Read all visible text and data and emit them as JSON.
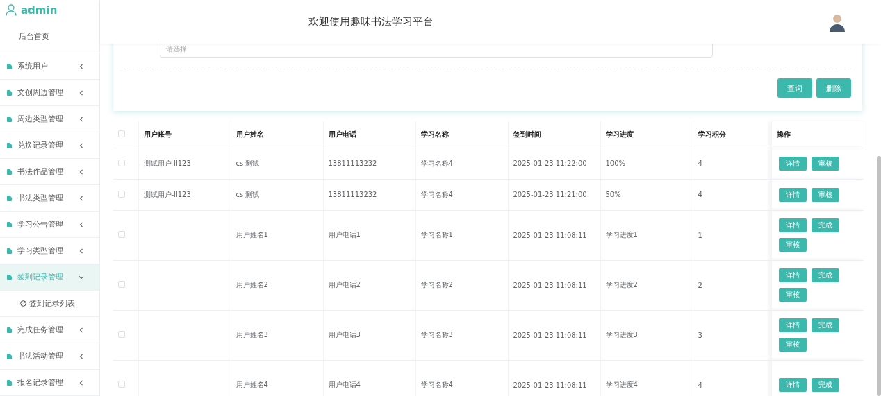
{
  "sidebar": {
    "user": "admin",
    "items": [
      {
        "label": "后台首页",
        "kind": "home",
        "selected": false
      },
      {
        "label": "系统用户",
        "kind": "menu",
        "selected": false,
        "expanded": false
      },
      {
        "label": "文创周边管理",
        "kind": "menu",
        "selected": false,
        "expanded": false
      },
      {
        "label": "周边类型管理",
        "kind": "menu",
        "selected": false,
        "expanded": false
      },
      {
        "label": "兑换记录管理",
        "kind": "menu",
        "selected": false,
        "expanded": false
      },
      {
        "label": "书法作品管理",
        "kind": "menu",
        "selected": false,
        "expanded": false
      },
      {
        "label": "书法类型管理",
        "kind": "menu",
        "selected": false,
        "expanded": false
      },
      {
        "label": "学习公告管理",
        "kind": "menu",
        "selected": false,
        "expanded": false
      },
      {
        "label": "学习类型管理",
        "kind": "menu",
        "selected": false,
        "expanded": false
      },
      {
        "label": "签到记录管理",
        "kind": "menu",
        "selected": true,
        "expanded": true,
        "children": [
          {
            "label": "签到记录列表"
          }
        ]
      },
      {
        "label": "完成任务管理",
        "kind": "menu",
        "selected": false,
        "expanded": false
      },
      {
        "label": "书法活动管理",
        "kind": "menu",
        "selected": false,
        "expanded": false
      },
      {
        "label": "报名记录管理",
        "kind": "menu",
        "selected": false,
        "expanded": false
      }
    ]
  },
  "header": {
    "title": "欢迎使用趣味书法学习平台"
  },
  "search": {
    "placeholder": "请选择",
    "buttons": [
      "查询",
      "删除"
    ]
  },
  "table": {
    "all_selected": false,
    "columns": [
      "用户账号",
      "用户姓名",
      "用户电话",
      "学习名称",
      "签到时间",
      "学习进度",
      "学习积分",
      "操作"
    ],
    "rows": [
      {
        "selected": false,
        "cells": [
          "测试用户-ll123",
          "cs 测试",
          "13811113232",
          "学习名称4",
          "2025-01-23 11:22:00",
          "100%",
          "4"
        ],
        "actions": [
          "详情",
          "审核"
        ]
      },
      {
        "selected": false,
        "cells": [
          "测试用户-ll123",
          "cs 测试",
          "13811113232",
          "学习名称4",
          "2025-01-23 11:21:00",
          "50%",
          "4"
        ],
        "actions": [
          "详情",
          "审核"
        ]
      },
      {
        "selected": false,
        "cells": [
          "",
          "用户姓名1",
          "用户电话1",
          "学习名称1",
          "2025-01-23 11:08:11",
          "学习进度1",
          "1"
        ],
        "actions": [
          "详情",
          "完成",
          "审核"
        ]
      },
      {
        "selected": false,
        "cells": [
          "",
          "用户姓名2",
          "用户电话2",
          "学习名称2",
          "2025-01-23 11:08:11",
          "学习进度2",
          "2"
        ],
        "actions": [
          "详情",
          "完成",
          "审核"
        ]
      },
      {
        "selected": false,
        "cells": [
          "",
          "用户姓名3",
          "用户电话3",
          "学习名称3",
          "2025-01-23 11:08:11",
          "学习进度3",
          "3"
        ],
        "actions": [
          "详情",
          "完成",
          "审核"
        ]
      },
      {
        "selected": false,
        "cells": [
          "",
          "用户姓名4",
          "用户电话4",
          "学习名称4",
          "2025-01-23 11:08:11",
          "学习进度4",
          "4"
        ],
        "actions": [
          "详情",
          "完成"
        ]
      }
    ]
  }
}
